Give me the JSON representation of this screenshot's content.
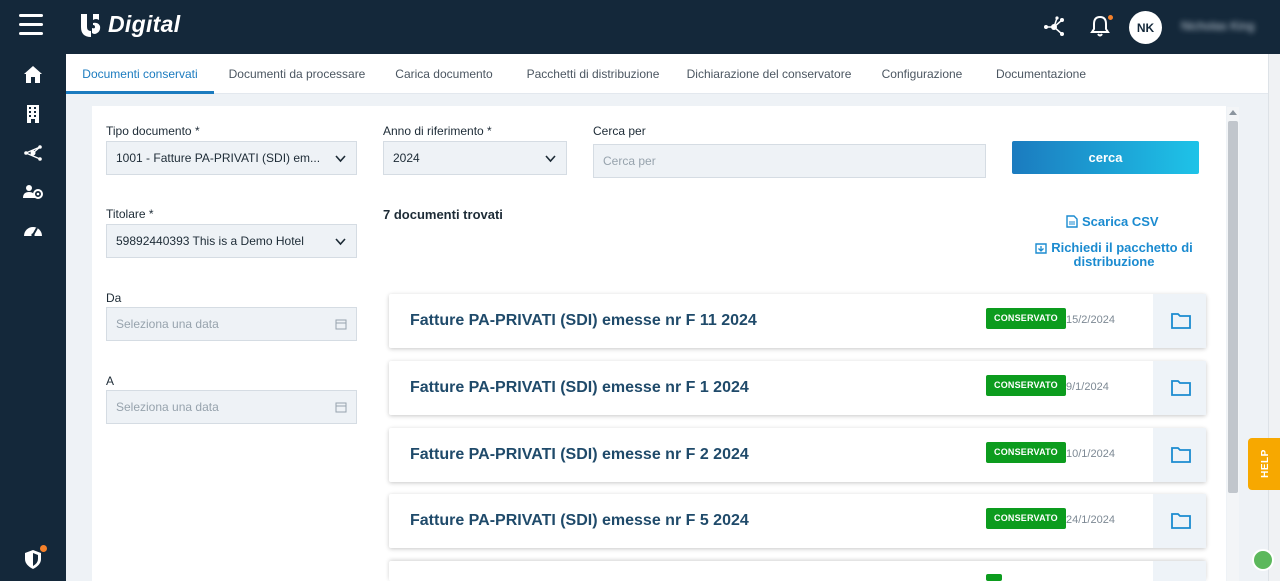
{
  "header": {
    "brand": "Digital",
    "avatar_initials": "NK",
    "username": "Nicholas King"
  },
  "icons": {
    "menu": "hamburger-icon",
    "logo": "logo-icon",
    "network": "network-icon",
    "bell": "bell-icon",
    "home": "home-icon",
    "building": "building-icon",
    "share": "share-icon",
    "users_settings": "users-gear-icon",
    "gauge": "gauge-icon",
    "shield": "shield-icon",
    "folder": "folder-icon",
    "calendar": "calendar-icon",
    "chevron": "chevron-down-icon",
    "csv": "file-csv-icon",
    "package": "package-download-icon"
  },
  "colors": {
    "navy": "#14283a",
    "accent": "#1b7bbf",
    "badge_green": "#0c9c1e",
    "help_orange": "#f7a800"
  },
  "tabs": [
    {
      "label": "Documenti conservati",
      "active": true
    },
    {
      "label": "Documenti da processare",
      "active": false
    },
    {
      "label": "Carica documento",
      "active": false
    },
    {
      "label": "Pacchetti di distribuzione",
      "active": false
    },
    {
      "label": "Dichiarazione del conservatore",
      "active": false
    },
    {
      "label": "Configurazione",
      "active": false
    },
    {
      "label": "Documentazione",
      "active": false
    }
  ],
  "filters": {
    "tipo_documento": {
      "label": "Tipo documento *",
      "value": "1001 - Fatture PA-PRIVATI (SDI) em..."
    },
    "anno": {
      "label": "Anno di riferimento *",
      "value": "2024"
    },
    "cerca_per": {
      "label": "Cerca per",
      "placeholder": "Cerca per"
    },
    "search_button": "cerca",
    "titolare": {
      "label": "Titolare *",
      "value": "59892440393 This is a Demo Hotel"
    },
    "da": {
      "label": "Da",
      "placeholder": "Seleziona una data"
    },
    "a": {
      "label": "A",
      "placeholder": "Seleziona una data"
    }
  },
  "results": {
    "count_text": "7 documenti trovati",
    "download_csv": "Scarica CSV",
    "request_package": "Richiedi il pacchetto di distribuzione",
    "items": [
      {
        "title": "Fatture PA-PRIVATI (SDI) emesse nr F 11 2024",
        "status": "CONSERVATO",
        "date": "15/2/2024"
      },
      {
        "title": "Fatture PA-PRIVATI (SDI) emesse nr F 1 2024",
        "status": "CONSERVATO",
        "date": "9/1/2024"
      },
      {
        "title": "Fatture PA-PRIVATI (SDI) emesse nr F 2 2024",
        "status": "CONSERVATO",
        "date": "10/1/2024"
      },
      {
        "title": "Fatture PA-PRIVATI (SDI) emesse nr F 5 2024",
        "status": "CONSERVATO",
        "date": "24/1/2024"
      }
    ]
  },
  "help": "HELP"
}
